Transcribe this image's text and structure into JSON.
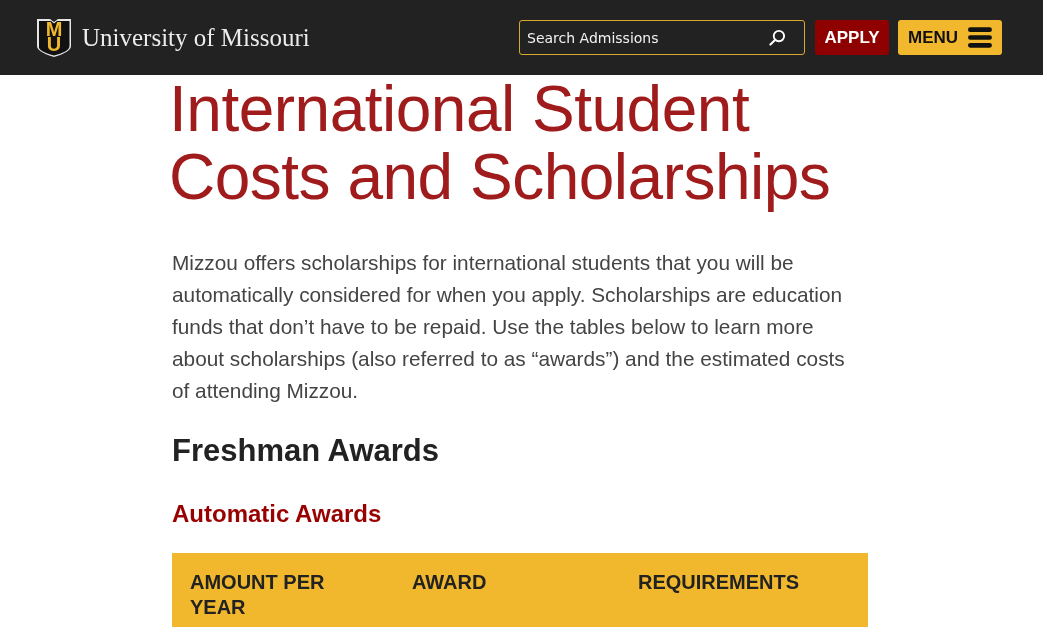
{
  "header": {
    "logo": {
      "mark": [
        "M",
        "U"
      ],
      "name": "University of Missouri"
    },
    "search": {
      "placeholder": "Search Admissions"
    },
    "buttons": [
      {
        "label": "APPLY",
        "kind": "apply"
      },
      {
        "label": "MENU",
        "kind": "menu"
      }
    ]
  },
  "page": {
    "title": "International Student Costs and Scholarships",
    "intro": "Mizzou offers scholarships for international students that you will be automatically considered for when you apply. Scholarships are education funds that don’t have to be repaid. Use the tables below to learn more about scholarships (also referred to as “awards”) and the estimated costs of attending Mizzou.",
    "section_heading": "Freshman Awards",
    "subsection_heading": "Automatic Awards",
    "table": {
      "columns": [
        "AMOUNT PER YEAR",
        "AWARD",
        "REQUIREMENTS"
      ]
    }
  }
}
